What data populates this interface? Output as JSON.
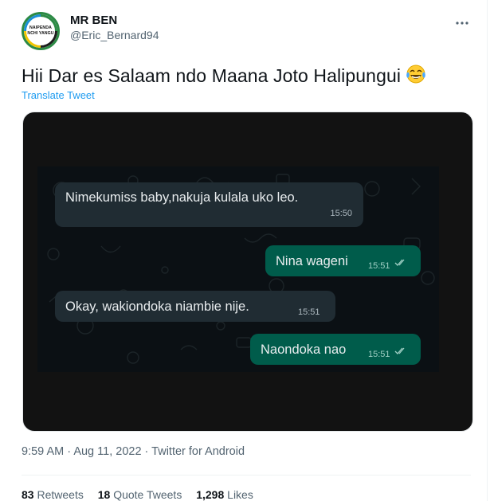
{
  "author": {
    "display_name": "MR BEN",
    "handle": "@Eric_Bernard94",
    "avatar_logo_line1": "NAIPENDA",
    "avatar_logo_line2": "NCHI YANGU"
  },
  "tweet": {
    "text": "Hii Dar es Salaam ndo Maana Joto Halipungui",
    "emoji": "face-with-tears-of-joy",
    "translate_label": "Translate Tweet"
  },
  "chat": {
    "messages": [
      {
        "direction": "in",
        "text": "Nimekumiss baby,nakuja kulala uko leo.",
        "time": "15:50"
      },
      {
        "direction": "out",
        "text": "Nina wageni",
        "time": "15:51"
      },
      {
        "direction": "in",
        "text": "Okay, wakiondoka niambie nije.",
        "time": "15:51"
      },
      {
        "direction": "out",
        "text": "Naondoka nao",
        "time": "15:51"
      }
    ]
  },
  "meta": {
    "time": "9:59 AM",
    "date": "Aug 11, 2022",
    "source": "Twitter for Android",
    "separator": "·"
  },
  "stats": {
    "retweets_count": "83",
    "retweets_label": "Retweets",
    "quote_count": "18",
    "quote_label": "Quote Tweets",
    "likes_count": "1,298",
    "likes_label": "Likes"
  },
  "colors": {
    "accent": "#1d9bf0",
    "incoming_bubble": "#202c33",
    "outgoing_bubble": "#005c4b",
    "logo_ring": "#2c8a45"
  }
}
